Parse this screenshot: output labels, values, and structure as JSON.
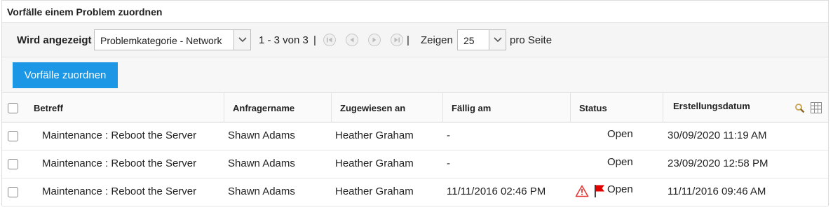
{
  "panel": {
    "title": "Vorfälle einem Problem zuordnen"
  },
  "toolbar": {
    "showing_label": "Wird angezeigt",
    "filter_value": "Problemkategorie - Network",
    "range_text": "1 - 3 von 3",
    "range_sep": "|",
    "pager_sep": "|",
    "show_label": "Zeigen",
    "per_page_value": "25",
    "per_page_suffix": "pro Seite"
  },
  "actions": {
    "assign_label": "Vorfälle zuordnen"
  },
  "table": {
    "columns": {
      "subject": "Betreff",
      "requester": "Anfragername",
      "assigned": "Zugewiesen an",
      "due": "Fällig am",
      "status": "Status",
      "created": "Erstellungsdatum"
    },
    "rows": [
      {
        "subject": "Maintenance : Reboot the Server",
        "requester": "Shawn Adams",
        "assigned": "Heather Graham",
        "due": "-",
        "status": "Open",
        "created": "30/09/2020 11:19 AM",
        "overdue": false,
        "flagged": false
      },
      {
        "subject": "Maintenance : Reboot the Server",
        "requester": "Shawn Adams",
        "assigned": "Heather Graham",
        "due": "-",
        "status": "Open",
        "created": "23/09/2020 12:58 PM",
        "overdue": false,
        "flagged": false
      },
      {
        "subject": "Maintenance : Reboot the Server",
        "requester": "Shawn Adams",
        "assigned": "Heather Graham",
        "due": "11/11/2016 02:46 PM",
        "status": "Open",
        "created": "11/11/2016 09:46 AM",
        "overdue": true,
        "flagged": true
      }
    ]
  },
  "icons": {
    "pager_first": "first-page-icon",
    "pager_prev": "previous-page-icon",
    "pager_next": "next-page-icon",
    "pager_last": "last-page-icon",
    "search": "search-icon",
    "columns": "column-chooser-icon",
    "warning": "warning-icon",
    "flag": "flag-icon"
  },
  "colors": {
    "primary_button": "#1c97e5",
    "warning": "#e53935",
    "flag": "#e00000"
  }
}
